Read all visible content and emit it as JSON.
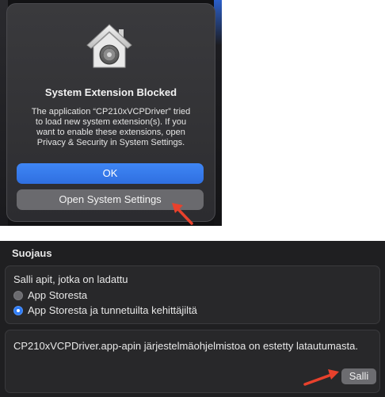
{
  "alert": {
    "title": "System Extension Blocked",
    "message": "The application “CP210xVCPDriver” tried\nto load new system extension(s). If you\nwant to enable these extensions, open\nPrivacy & Security in System Settings.",
    "ok_label": "OK",
    "open_settings_label": "Open System Settings",
    "icon": "security-house-lock-icon"
  },
  "security": {
    "header": "Suojaus",
    "allow_apps_label": "Salli apit, jotka on ladattu",
    "options": [
      {
        "label": "App Storesta",
        "selected": false
      },
      {
        "label": "App Storesta ja tunnetuilta kehittäjiltä",
        "selected": true
      }
    ],
    "blocked_message": "CP210xVCPDriver.app-apin järjestelmäohjelmistoa on estetty latautumasta.",
    "allow_button_label": "Salli"
  },
  "colors": {
    "accent": "#2f7cf6",
    "annotation_arrow": "#e8412c"
  }
}
